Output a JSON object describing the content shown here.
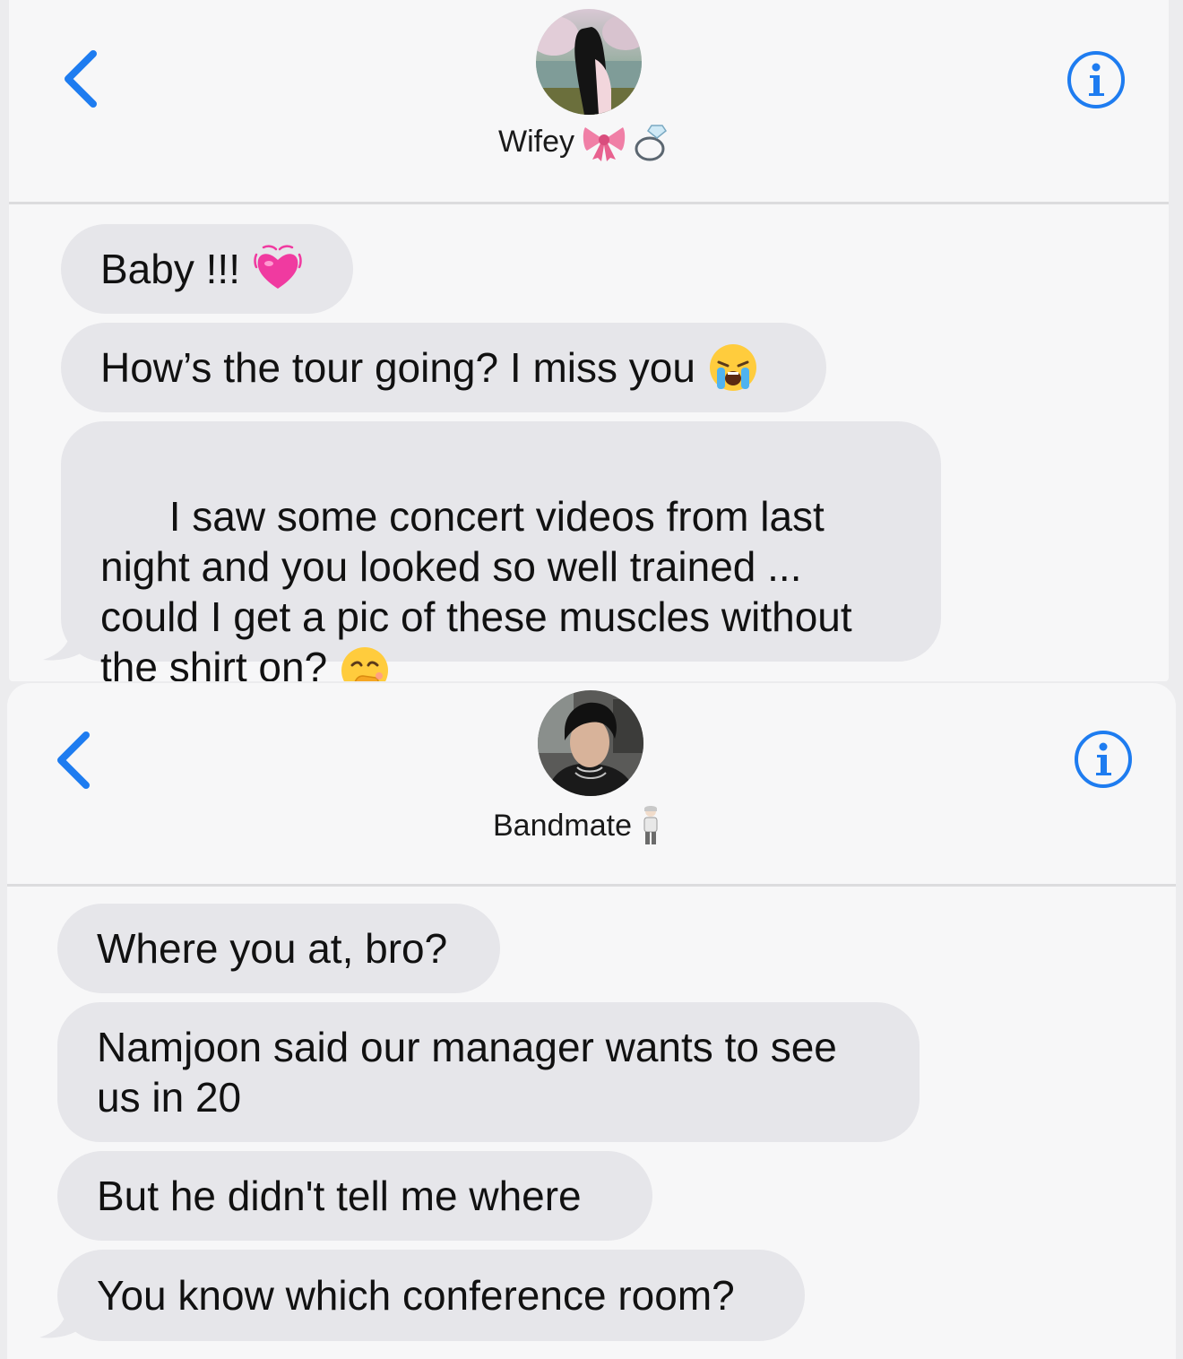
{
  "conversations": [
    {
      "contact": {
        "name": "Wifey",
        "name_emojis": [
          "ribbon-emoji",
          "ring-emoji"
        ]
      },
      "messages": [
        {
          "text": "Baby !!!",
          "emoji": "growing-heart-emoji"
        },
        {
          "text": "How’s the tour going? I miss you",
          "emoji": "crying-face-emoji"
        },
        {
          "text": "I saw some concert videos from last night and you looked so well trained ... could I get a pic of these muscles without the shirt on?",
          "emoji": "face-with-hand-over-mouth-emoji"
        }
      ]
    },
    {
      "contact": {
        "name": "Bandmate",
        "name_emojis": [
          "person-standing-emoji"
        ]
      },
      "messages": [
        {
          "text": "Where you at, bro?"
        },
        {
          "text": "Namjoon said our manager wants to see us in 20"
        },
        {
          "text": "But he didn't tell me where"
        },
        {
          "text": "You know which conference room?"
        }
      ]
    }
  ],
  "colors": {
    "accent": "#1e7cf0",
    "bubble_incoming": "#e6e6ea",
    "background": "#f7f7f8"
  }
}
